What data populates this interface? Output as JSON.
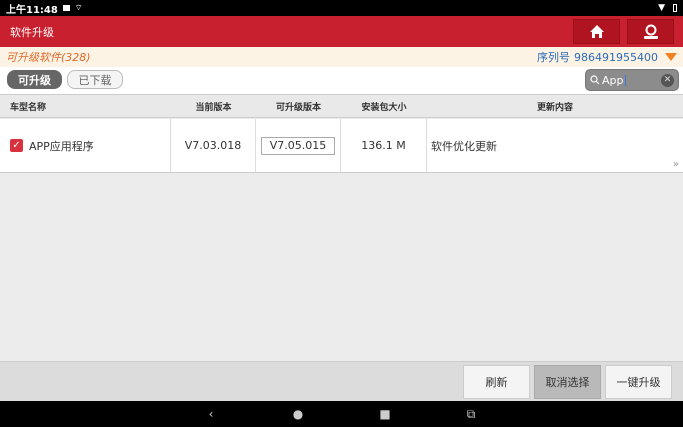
{
  "status": {
    "time": "上午11:48"
  },
  "title": "软件升级",
  "info": {
    "count_label": "可升级软件(328)",
    "serial_label": "序列号",
    "serial_value": "986491955400"
  },
  "tabs": [
    {
      "label": "可升级"
    },
    {
      "label": "已下载"
    }
  ],
  "search": {
    "value": "App"
  },
  "table": {
    "headers": [
      "车型名称",
      "当前版本",
      "可升级版本",
      "安装包大小",
      "更新内容"
    ],
    "rows": [
      {
        "name": "APP应用程序",
        "current": "V7.03.018",
        "upgrade": "V7.05.015",
        "size": "136.1 M",
        "content": "软件优化更新"
      }
    ]
  },
  "buttons": {
    "refresh": "刷新",
    "deselect": "取消选择",
    "upgrade_all": "一键升级"
  },
  "colors": {
    "titlebar": "#c8202e",
    "accent_orange": "#f08020",
    "serial_blue": "#2b6cb6"
  },
  "icons": {
    "home": "home-icon",
    "user": "user-icon"
  }
}
